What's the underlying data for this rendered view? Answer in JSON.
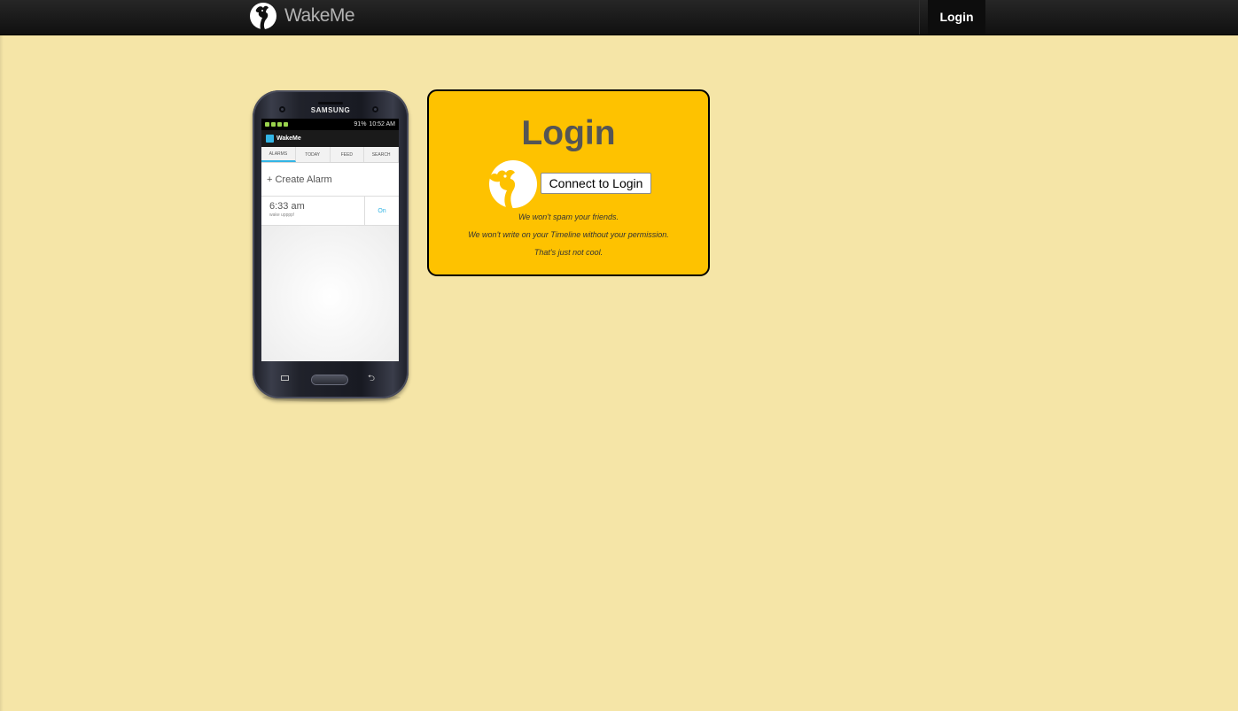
{
  "navbar": {
    "brand": "WakeMe",
    "login_label": "Login"
  },
  "phone": {
    "maker": "SAMSUNG",
    "status_time": "10:52 AM",
    "status_battery": "91%",
    "app_title": "WakeMe",
    "tabs": [
      {
        "label": "ALARMS"
      },
      {
        "label": "TODAY"
      },
      {
        "label": "FEED"
      },
      {
        "label": "SEARCH"
      }
    ],
    "create_alarm_label": "+ Create Alarm",
    "alarm": {
      "time": "6:33 am",
      "note": "wake upppp!",
      "state": "On"
    }
  },
  "login": {
    "title": "Login",
    "connect_button": "Connect to Login",
    "notes": [
      "We won't spam your friends.",
      "We won't write on your Timeline without your permission.",
      "That's just not cool."
    ]
  },
  "colors": {
    "background": "#f5e5a7",
    "card": "#fec200",
    "navbar": "#1a1a1a",
    "accent": "#33b5e5"
  }
}
